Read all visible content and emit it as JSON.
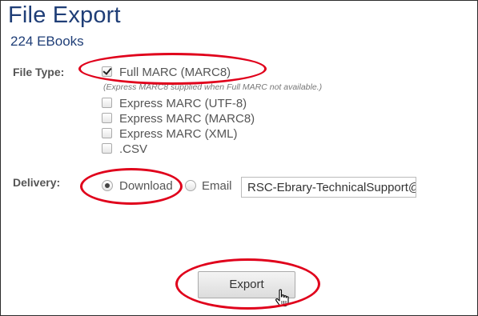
{
  "header": {
    "title": "File Export",
    "subtitle": "224 EBooks"
  },
  "file_type": {
    "label": "File Type:",
    "options": [
      {
        "label": "Full MARC (MARC8)",
        "checked": true
      },
      {
        "label": "Express MARC (UTF-8)",
        "checked": false
      },
      {
        "label": "Express MARC (MARC8)",
        "checked": false
      },
      {
        "label": "Express MARC (XML)",
        "checked": false
      },
      {
        "label": ".CSV",
        "checked": false
      }
    ],
    "note": "(Express MARC8 supplied when Full MARC not available.)"
  },
  "delivery": {
    "label": "Delivery:",
    "options": [
      {
        "label": "Download",
        "selected": true
      },
      {
        "label": "Email",
        "selected": false
      }
    ],
    "email_value": "RSC-Ebrary-TechnicalSupport@"
  },
  "actions": {
    "export_label": "Export"
  },
  "colors": {
    "title": "#1f3e77",
    "annotation": "#e0001b"
  }
}
